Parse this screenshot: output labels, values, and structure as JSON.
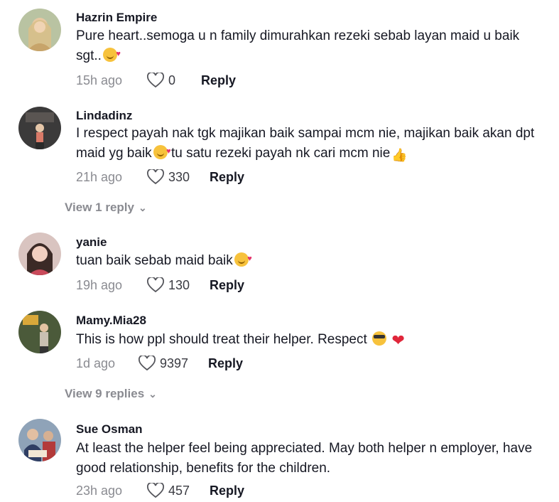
{
  "comments": [
    {
      "username": "Hazrin Empire",
      "text_parts": [
        "Pure heart..semoga u n family dimurahkan rezeki sebab layan maid u baik sgt.."
      ],
      "time": "15h ago",
      "likes": "0",
      "reply_label": "Reply",
      "emoji": [
        "smiling-face-with-hearts"
      ]
    },
    {
      "username": "Lindadinz",
      "text_parts": [
        "I respect payah nak tgk majikan baik sampai mcm nie, majikan baik akan dpt maid yg baik",
        " tu satu rezeki payah nk cari mcm nie"
      ],
      "time": "21h ago",
      "likes": "330",
      "reply_label": "Reply",
      "view_replies": "View 1 reply",
      "emoji": [
        "smiling-face-with-hearts",
        "thumbs-up"
      ]
    },
    {
      "username": "yanie",
      "text_parts": [
        "tuan baik sebab maid baik"
      ],
      "time": "19h ago",
      "likes": "130",
      "reply_label": "Reply",
      "emoji": [
        "smiling-face-with-hearts"
      ]
    },
    {
      "username": "Mamy.Mia28",
      "text_parts": [
        "This is how ppl should treat their helper. Respect"
      ],
      "time": "1d ago",
      "likes": "9397",
      "reply_label": "Reply",
      "view_replies": "View 9 replies",
      "emoji": [
        "smiling-face-with-sunglasses",
        "red-heart"
      ]
    },
    {
      "username": "Sue Osman",
      "text_parts": [
        "At least the helper feel being appreciated. May both helper n employer, have good relationship, benefits for the children."
      ],
      "time": "23h ago",
      "likes": "457",
      "reply_label": "Reply"
    }
  ],
  "colors": {
    "primary_text": "#161823",
    "secondary_text": "#8a8b91"
  },
  "icons": {
    "like": "heart-outline-icon",
    "expand": "chevron-down-icon"
  }
}
